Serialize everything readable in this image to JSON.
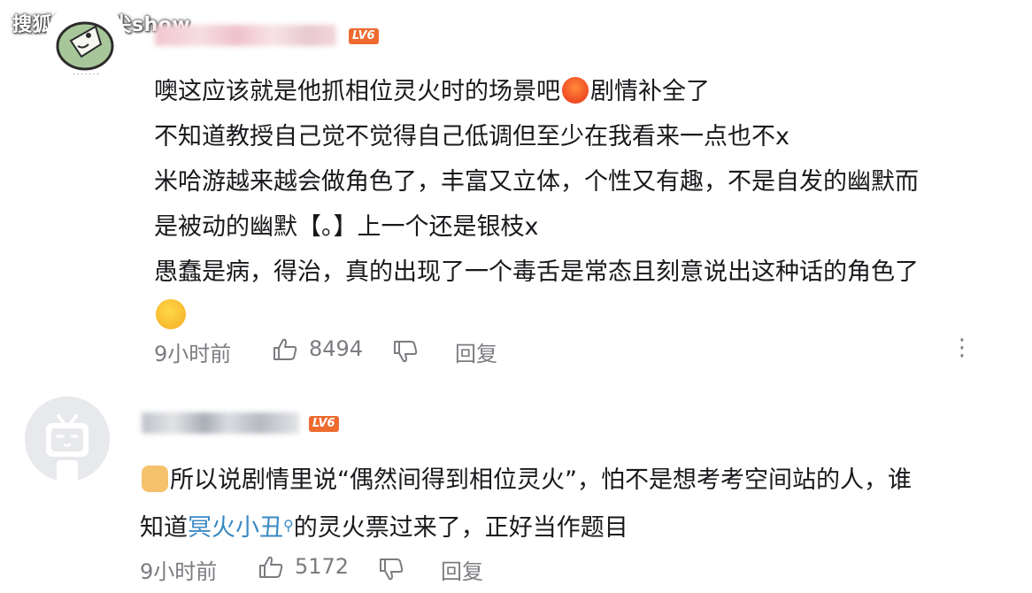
{
  "watermark": "搜狐号@指尖show",
  "comments": [
    {
      "level": "LV6",
      "lines": [
        {
          "text": "噢这应该就是他抓相位灵火时的场景吧",
          "emoji": "angry-face-emoji",
          "after": "剧情补全了"
        },
        {
          "text": "不知道教授自己觉不觉得自己低调但至少在我看来一点也不x"
        },
        {
          "text": "米哈游越来越会做角色了，丰富又立体，个性又有趣，不是自发的幽默而"
        },
        {
          "text": "是被动的幽默【。】上一个还是银枝x"
        },
        {
          "text": "愚蠢是病，得治，真的出现了一个毒舌是常态且刻意说出这种话的角色了"
        }
      ],
      "trailing_emoji": "crying-laughing-emoji",
      "time": "9小时前",
      "likes": "8494",
      "reply_label": "回复"
    },
    {
      "level": "LV6",
      "line1": "所以说剧情里说“偶然间得到相位灵火”，怕不是想考考空间站的人，谁",
      "line2_before": "知道",
      "line2_link": "冥火小丑",
      "line2_after": "的灵火票过来了，正好当作题目",
      "time": "9小时前",
      "likes": "5172",
      "reply_label": "回复"
    }
  ],
  "colors": {
    "text": "#18191c",
    "meta": "#7a7c80",
    "link": "#3a8ac4",
    "badge": "#ee6a2f"
  }
}
